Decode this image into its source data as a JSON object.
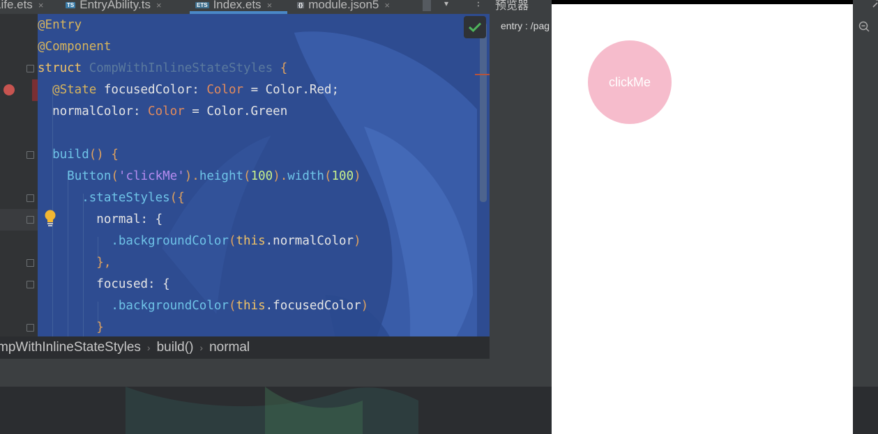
{
  "tabs": [
    {
      "label": "Life.ets",
      "badge": ""
    },
    {
      "label": "EntryAbility.ts",
      "badge": "TS"
    },
    {
      "label": "Index.ets",
      "badge": "ETS",
      "active": true
    },
    {
      "label": "module.json5",
      "badge": "{}"
    }
  ],
  "tab_close": "×",
  "code": [
    [
      "@Entry"
    ],
    [
      "@Component"
    ],
    [
      "struct ",
      "CompWithInlineStateStyles",
      " {"
    ],
    [
      "  ",
      "@State",
      " focusedColor: ",
      "Color",
      " = Color.Red;"
    ],
    [
      "  normalColor: ",
      "Color",
      " = Color.Green"
    ],
    [
      ""
    ],
    [
      "  ",
      "build",
      "() {"
    ],
    [
      "    ",
      "Button",
      "(",
      "'clickMe'",
      ").",
      "height",
      "(",
      "100",
      ").",
      "width",
      "(",
      "100",
      ")"
    ],
    [
      "      ",
      ".stateStyles",
      "({"
    ],
    [
      "        normal: {"
    ],
    [
      "          ",
      ".backgroundColor",
      "(",
      "this",
      ".normalColor",
      ")"
    ],
    [
      "        },"
    ],
    [
      "        focused: {"
    ],
    [
      "          ",
      ".backgroundColor",
      "(",
      "this",
      ".focusedColor",
      ")"
    ],
    [
      "        }"
    ]
  ],
  "breadcrumb": [
    "mpWithInlineStateStyles",
    "build()",
    "normal"
  ],
  "breadcrumb_sep": "›",
  "previewer": {
    "title": "预览器",
    "path": "entry : /pag",
    "button_label": "clickMe"
  }
}
